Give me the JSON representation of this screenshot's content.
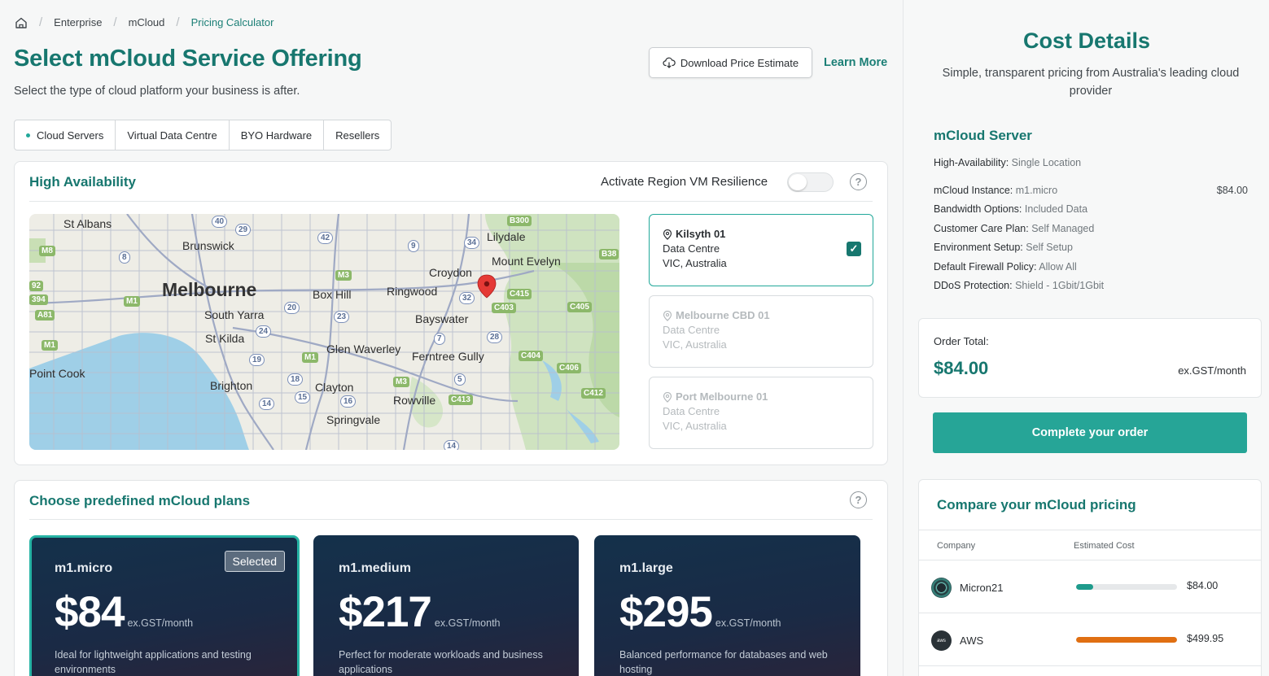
{
  "breadcrumb": {
    "items": [
      "Enterprise",
      "mCloud",
      "Pricing Calculator"
    ]
  },
  "header": {
    "title": "Select mCloud Service Offering",
    "subtitle": "Select the type of cloud platform your business is after.",
    "download_label": "Download Price Estimate",
    "learn_more_label": "Learn More"
  },
  "tabs": [
    {
      "label": "Cloud Servers",
      "active": true
    },
    {
      "label": "Virtual Data Centre"
    },
    {
      "label": "BYO Hardware"
    },
    {
      "label": "Resellers"
    }
  ],
  "high_availability": {
    "title": "High Availability",
    "resilience_label": "Activate Region VM Resilience",
    "resilience_enabled": false
  },
  "map": {
    "labels": {
      "melbourne": "Melbourne",
      "st_albans": "St Albans",
      "brunswick": "Brunswick",
      "south_yarra": "South Yarra",
      "st_kilda": "St Kilda",
      "point_cook": "Point Cook",
      "brighton": "Brighton",
      "clayton": "Clayton",
      "springvale": "Springvale",
      "box_hill": "Box Hill",
      "ringwood": "Ringwood",
      "croydon": "Croydon",
      "lilydale": "Lilydale",
      "mount_evelyn": "Mount Evelyn",
      "bayswater": "Bayswater",
      "glen_waverley": "Glen Waverley",
      "ferntree_gully": "Ferntree Gully",
      "rowville": "Rowville"
    },
    "shields": {
      "r40": "40",
      "r29": "29",
      "r42": "42",
      "r9": "9",
      "r34": "34",
      "r8": "8",
      "m8": "M8",
      "r92": "92",
      "r394": "394",
      "a81": "A81",
      "m1a": "M1",
      "m3a": "M3",
      "r20": "20",
      "r23": "23",
      "r24": "24",
      "r32": "32",
      "r7": "7",
      "r28": "28",
      "m1b": "M1",
      "r19": "19",
      "m1c": "M1",
      "r18": "18",
      "m3b": "M3",
      "r5": "5",
      "r15": "15",
      "r16": "16",
      "r14a": "14",
      "r14b": "14",
      "b300": "B300",
      "b38": "B38",
      "c415": "C415",
      "c403": "C403",
      "c405": "C405",
      "c404": "C404",
      "c406": "C406",
      "c413": "C413",
      "c412": "C412"
    }
  },
  "locations": [
    {
      "name": "Kilsyth 01",
      "type": "Data Centre",
      "region": "VIC, Australia",
      "selected": true
    },
    {
      "name": "Melbourne CBD 01",
      "type": "Data Centre",
      "region": "VIC, Australia",
      "selected": false
    },
    {
      "name": "Port Melbourne 01",
      "type": "Data Centre",
      "region": "VIC, Australia",
      "selected": false
    }
  ],
  "plans": {
    "title": "Choose predefined mCloud plans",
    "items": [
      {
        "name": "m1.micro",
        "price": "$84",
        "unit": "ex.GST/month",
        "desc": "Ideal for lightweight applications and testing environments",
        "badge": "Selected"
      },
      {
        "name": "m1.medium",
        "price": "$217",
        "unit": "ex.GST/month",
        "desc": "Perfect for moderate workloads and business applications"
      },
      {
        "name": "m1.large",
        "price": "$295",
        "unit": "ex.GST/month",
        "desc": "Balanced performance for databases and web hosting"
      }
    ]
  },
  "cost_details": {
    "title": "Cost Details",
    "subtitle": "Simple, transparent pricing from Australia's leading cloud provider",
    "server_title": "mCloud Server",
    "specs": [
      {
        "label": "High-Availability:",
        "value": "Single Location"
      },
      {
        "label": "mCloud Instance:",
        "value": "m1.micro",
        "price": "$84.00"
      },
      {
        "label": "Bandwidth Options:",
        "value": "Included Data"
      },
      {
        "label": "Customer Care Plan:",
        "value": "Self Managed"
      },
      {
        "label": "Environment Setup:",
        "value": "Self Setup"
      },
      {
        "label": "Default Firewall Policy:",
        "value": "Allow All"
      },
      {
        "label": "DDoS Protection:",
        "value": "Shield - 1Gbit/1Gbit"
      }
    ],
    "order_total_label": "Order Total:",
    "order_total": "$84.00",
    "order_unit": "ex.GST/month",
    "complete_label": "Complete your order"
  },
  "compare": {
    "title": "Compare your mCloud pricing",
    "col_company": "Company",
    "col_cost": "Estimated Cost",
    "rows": [
      {
        "company": "Micron21",
        "cost": "$84.00",
        "fraction": 0.168,
        "color": "#1e9b8c",
        "logo_text": ""
      },
      {
        "company": "AWS",
        "cost": "$499.95",
        "fraction": 1.0,
        "color": "#e06f12",
        "logo_text": "aws"
      }
    ]
  },
  "colors": {
    "brand": "#17776f",
    "accent": "#26a597",
    "plan_bg": "#14314b"
  }
}
